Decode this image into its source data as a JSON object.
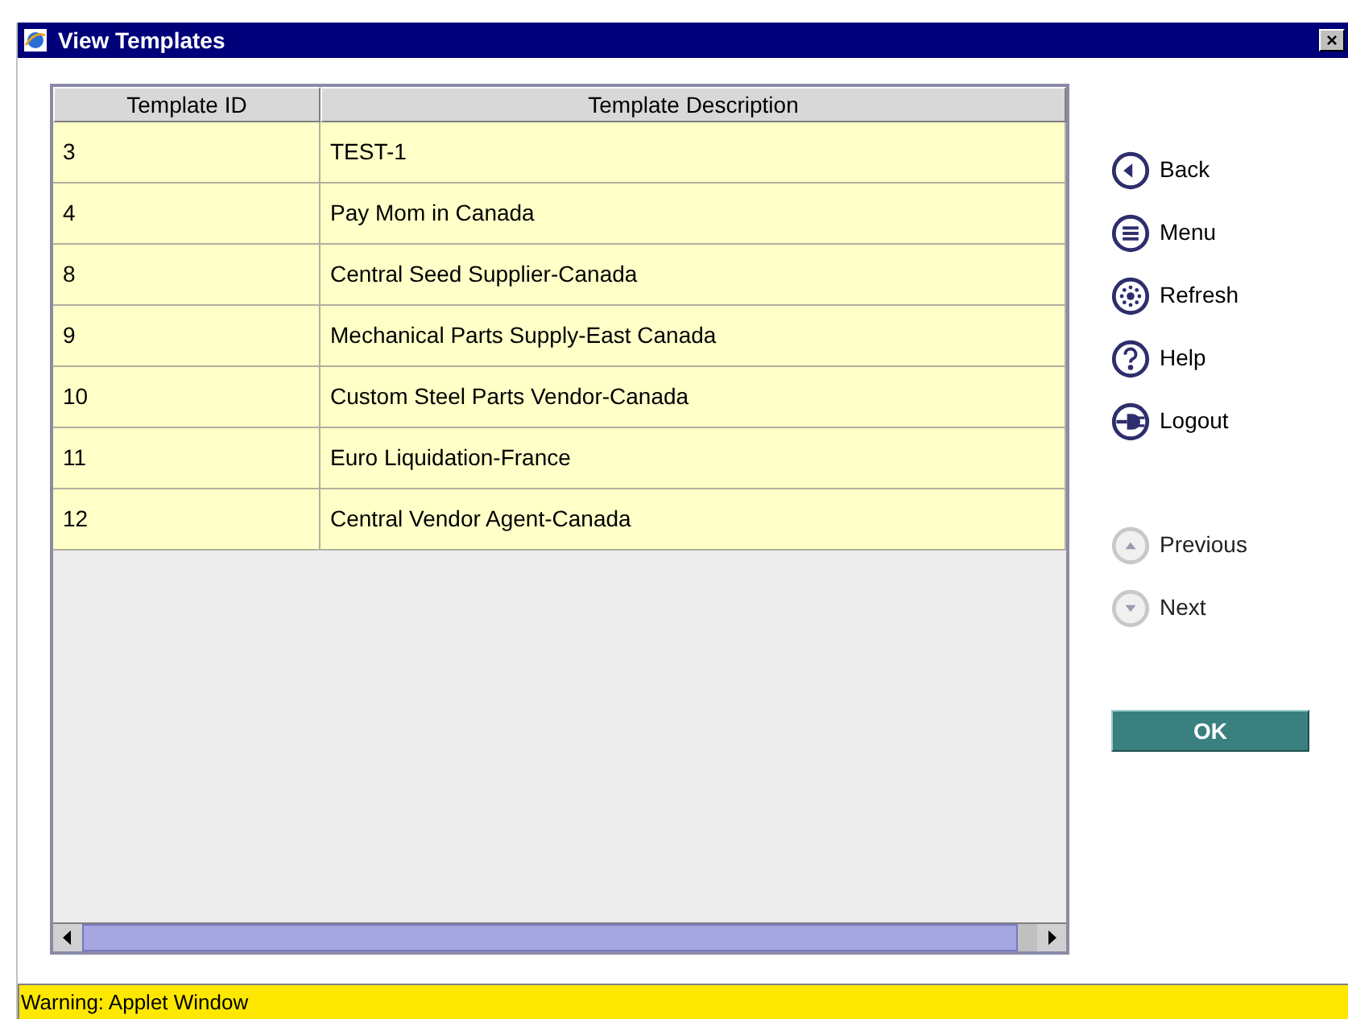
{
  "window": {
    "title": "View Templates",
    "close": "×"
  },
  "table": {
    "columns": [
      "Template ID",
      "Template Description"
    ],
    "rows": [
      [
        "3",
        "TEST-1"
      ],
      [
        "4",
        "Pay Mom in Canada"
      ],
      [
        "8",
        "Central Seed Supplier-Canada"
      ],
      [
        "9",
        "Mechanical Parts Supply-East Canada"
      ],
      [
        "10",
        "Custom Steel Parts Vendor-Canada"
      ],
      [
        "11",
        "Euro Liquidation-France"
      ],
      [
        "12",
        "Central Vendor Agent-Canada"
      ]
    ]
  },
  "nav": [
    {
      "label": "Back",
      "kind": "back",
      "disabled": false
    },
    {
      "label": "Menu",
      "kind": "menu",
      "disabled": false
    },
    {
      "label": "Refresh",
      "kind": "refresh",
      "disabled": false
    },
    {
      "label": "Help",
      "kind": "help",
      "disabled": false
    },
    {
      "label": "Logout",
      "kind": "logout",
      "disabled": false
    }
  ],
  "paging": [
    {
      "label": "Previous",
      "kind": "up",
      "disabled": true
    },
    {
      "label": "Next",
      "kind": "down",
      "disabled": true
    }
  ],
  "ok_button": "OK",
  "status_bar": "Warning: Applet Window"
}
